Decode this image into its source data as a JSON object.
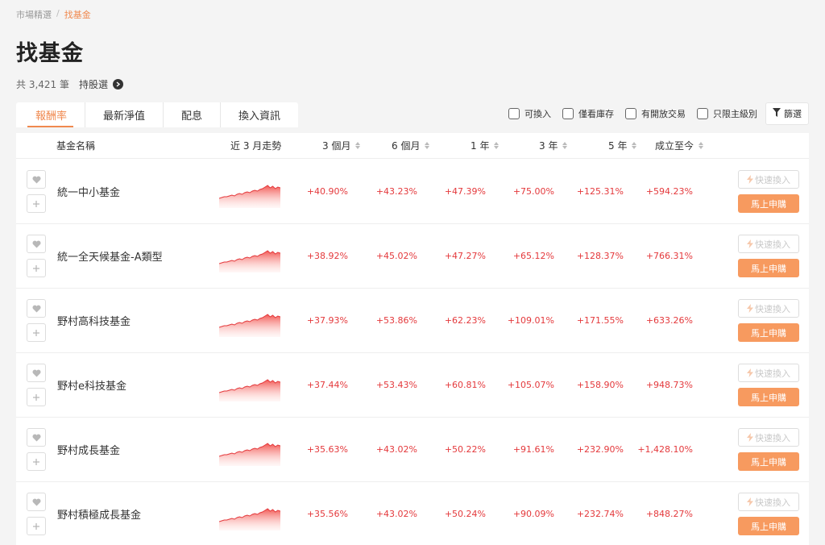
{
  "breadcrumb": {
    "parent": "市場精選",
    "separator": "/",
    "current": "找基金"
  },
  "page_title": "找基金",
  "summary": {
    "count_text": "共 3,421 筆",
    "link_label": "持股選"
  },
  "tabs": [
    {
      "label": "報酬率",
      "active": true
    },
    {
      "label": "最新淨值",
      "active": false
    },
    {
      "label": "配息",
      "active": false
    },
    {
      "label": "換入資訊",
      "active": false
    }
  ],
  "filters": {
    "options": [
      "可換入",
      "僅看庫存",
      "有開放交易",
      "只限主級別"
    ],
    "filter_button": "篩選"
  },
  "table": {
    "headers": {
      "name": "基金名稱",
      "trend": "近 3 月走勢",
      "m3": "3 個月",
      "m6": "6 個月",
      "y1": "1 年",
      "y3": "3 年",
      "y5": "5 年",
      "since": "成立至今"
    },
    "quick_label": "快速換入",
    "buy_label": "馬上申購",
    "rows": [
      {
        "name": "統一中小基金",
        "m3": "+40.90%",
        "m6": "+43.23%",
        "y1": "+47.39%",
        "y3": "+75.00%",
        "y5": "+125.31%",
        "since": "+594.23%"
      },
      {
        "name": "統一全天候基金-A類型",
        "m3": "+38.92%",
        "m6": "+45.02%",
        "y1": "+47.27%",
        "y3": "+65.12%",
        "y5": "+128.37%",
        "since": "+766.31%"
      },
      {
        "name": "野村高科技基金",
        "m3": "+37.93%",
        "m6": "+53.86%",
        "y1": "+62.23%",
        "y3": "+109.01%",
        "y5": "+171.55%",
        "since": "+633.26%"
      },
      {
        "name": "野村e科技基金",
        "m3": "+37.44%",
        "m6": "+53.43%",
        "y1": "+60.81%",
        "y3": "+105.07%",
        "y5": "+158.90%",
        "since": "+948.73%"
      },
      {
        "name": "野村成長基金",
        "m3": "+35.63%",
        "m6": "+43.02%",
        "y1": "+50.22%",
        "y3": "+91.61%",
        "y5": "+232.90%",
        "since": "+1,428.10%"
      },
      {
        "name": "野村積極成長基金",
        "m3": "+35.56%",
        "m6": "+43.02%",
        "y1": "+50.24%",
        "y3": "+90.09%",
        "y5": "+232.74%",
        "since": "+848.27%"
      }
    ]
  },
  "colors": {
    "accent": "#f0894f",
    "buy_button": "#f79a5f",
    "gain_red": "#e4393c"
  },
  "icons": {
    "favorite": "heart-icon",
    "add": "plus-icon",
    "filter": "funnel-icon",
    "quick": "lightning-icon",
    "link": "chevron-right-icon"
  }
}
